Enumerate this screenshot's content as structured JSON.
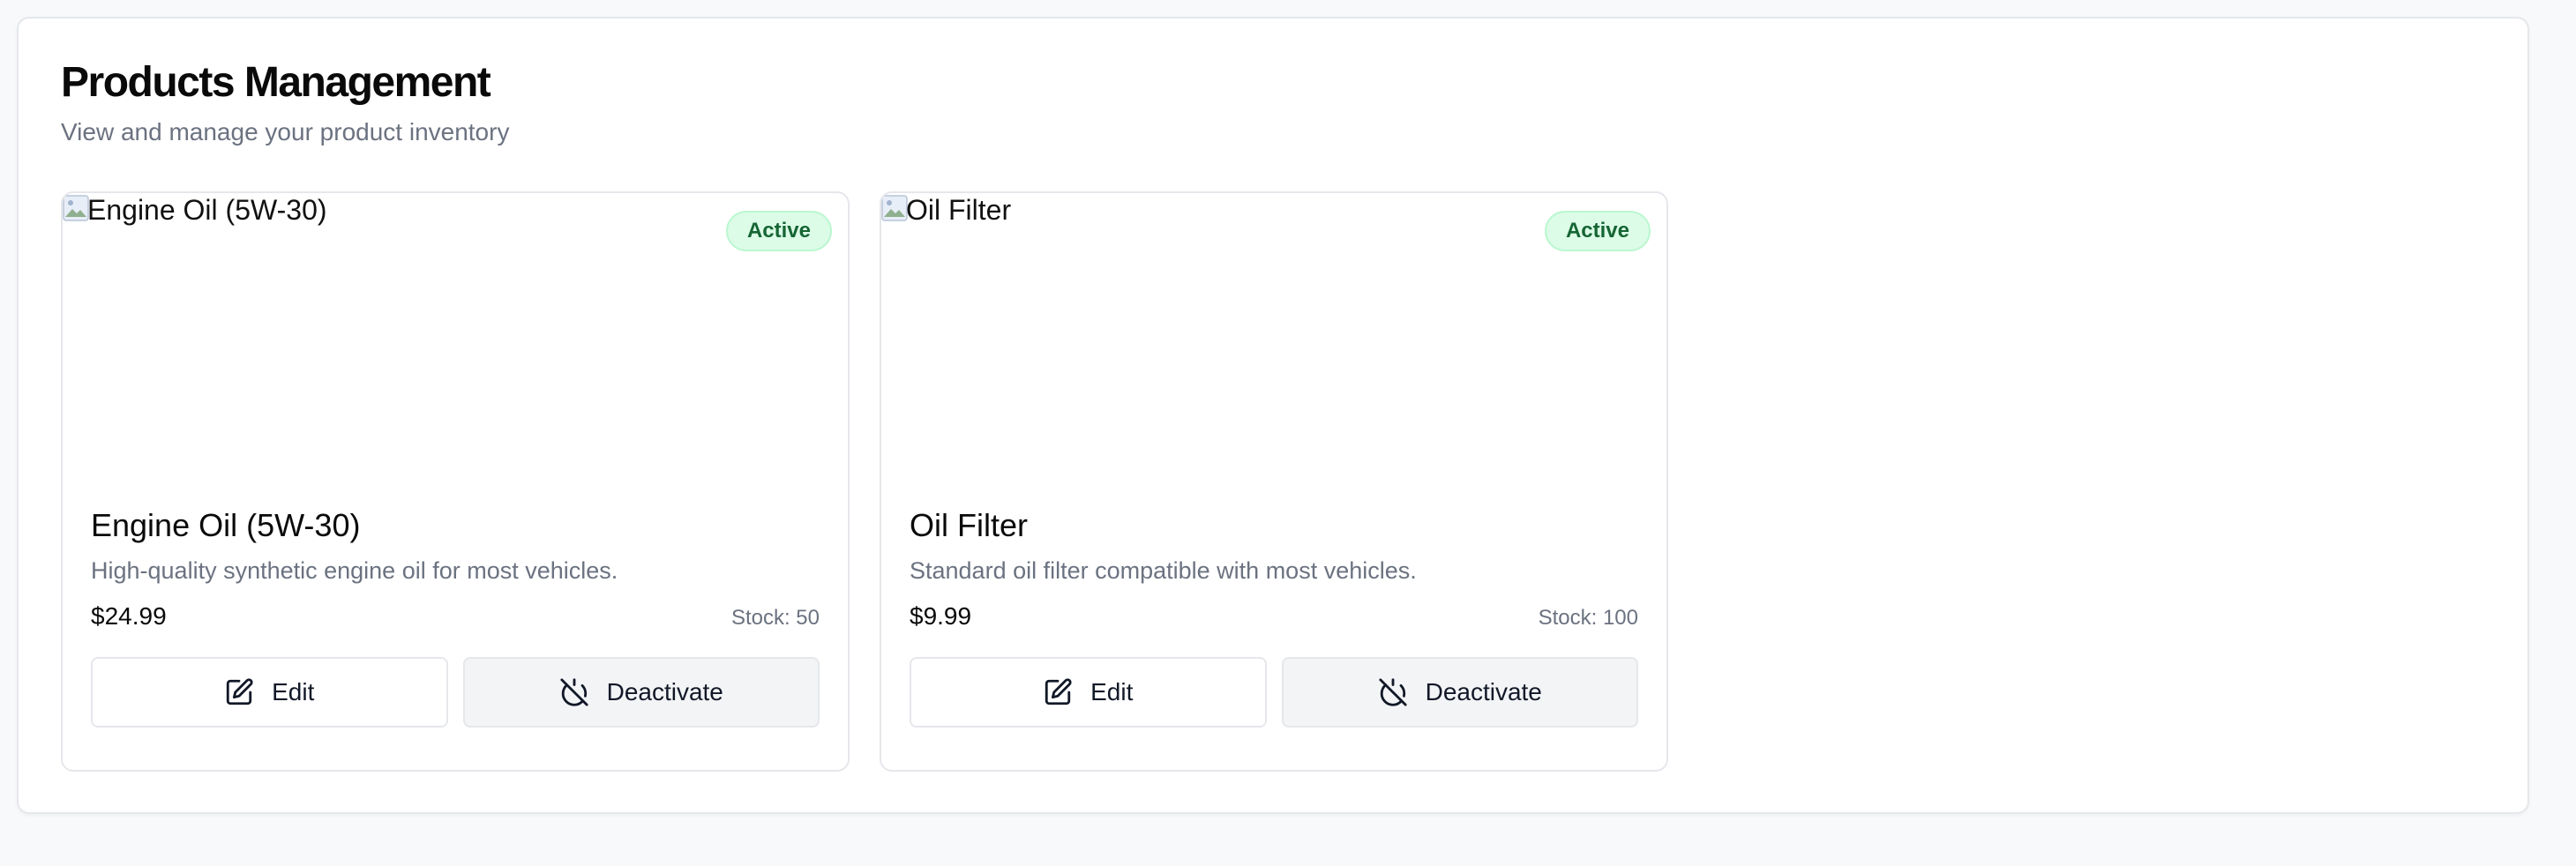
{
  "page": {
    "title": "Products Management",
    "subtitle": "View and manage your product inventory"
  },
  "colors": {
    "badge_bg": "#dcfce7",
    "badge_text": "#166534",
    "muted_text": "#6b7280",
    "deactivate_bg": "#f3f4f6"
  },
  "products": [
    {
      "image_alt": "Engine Oil (5W-30)",
      "status": "Active",
      "name": "Engine Oil (5W-30)",
      "description": "High-quality synthetic engine oil for most vehicles.",
      "price": "$24.99",
      "stock": "Stock: 50",
      "edit_label": "Edit",
      "edit_icon": "pencil-square-icon",
      "deactivate_label": "Deactivate",
      "deactivate_icon": "power-off-icon"
    },
    {
      "image_alt": "Oil Filter",
      "status": "Active",
      "name": "Oil Filter",
      "description": "Standard oil filter compatible with most vehicles.",
      "price": "$9.99",
      "stock": "Stock: 100",
      "edit_label": "Edit",
      "edit_icon": "pencil-square-icon",
      "deactivate_label": "Deactivate",
      "deactivate_icon": "power-off-icon"
    }
  ]
}
